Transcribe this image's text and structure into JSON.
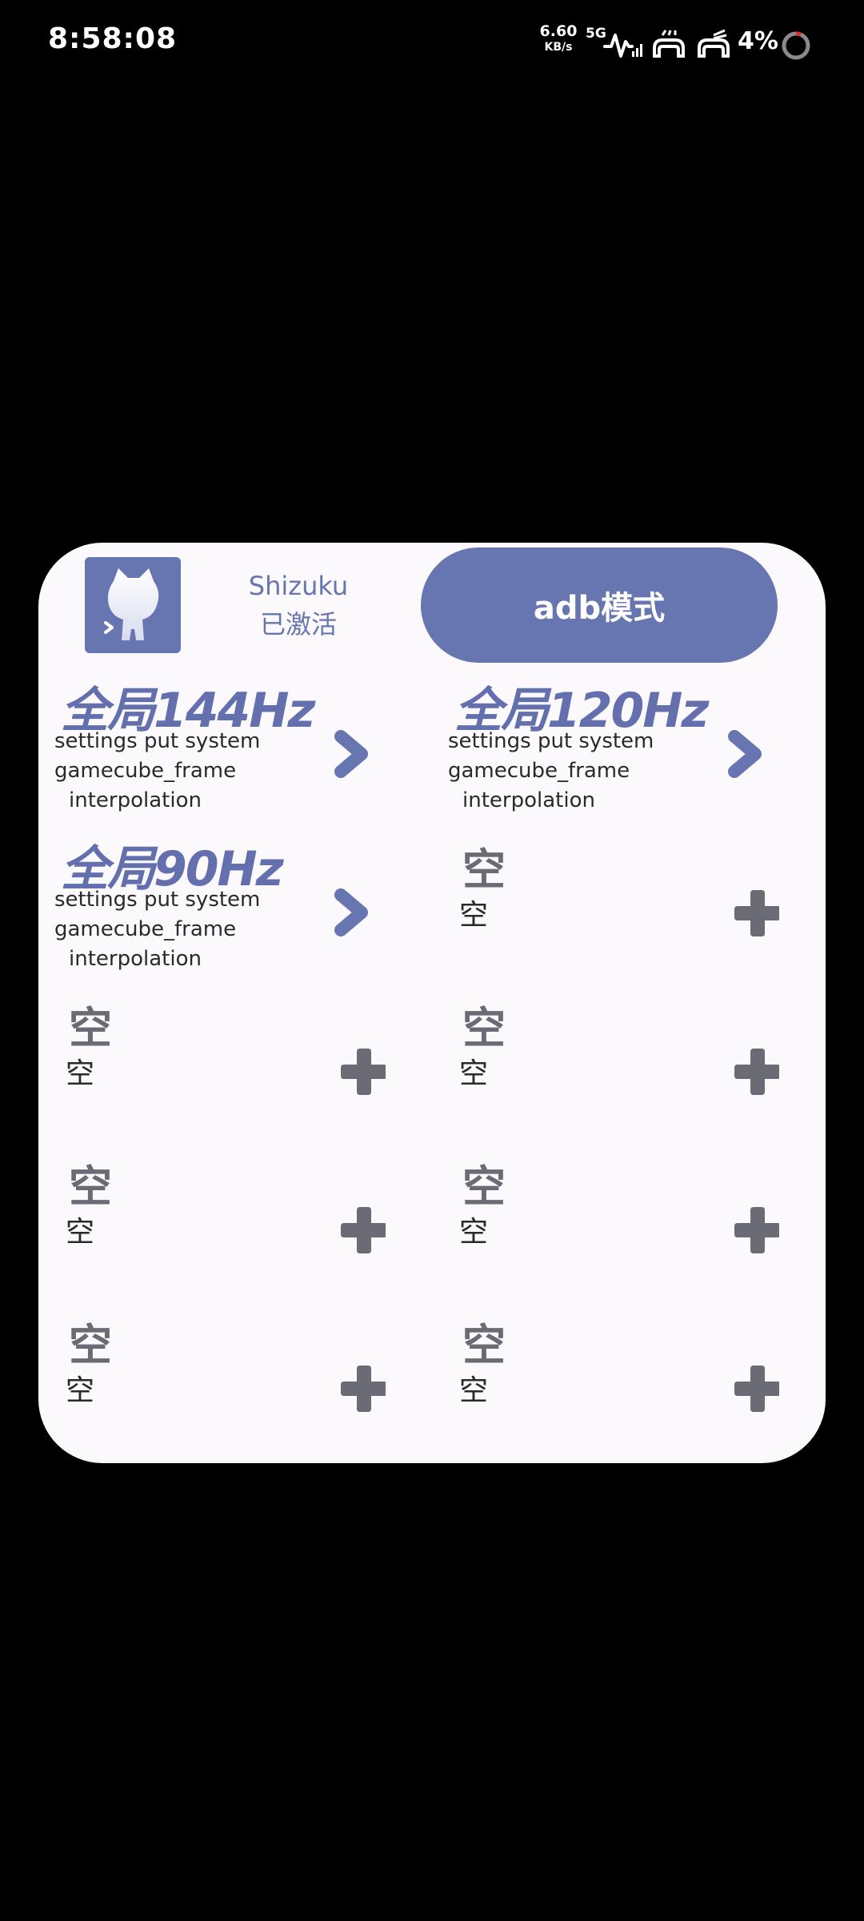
{
  "status_bar": {
    "time": "8:58:08",
    "net_speed_value": "6.60",
    "net_speed_unit": "KB/s",
    "network_type": "5G",
    "battery": "4%"
  },
  "header": {
    "app_icon": "shizuku-cat-icon",
    "shizuku_name": "Shizuku",
    "shizuku_status": "已激活",
    "mode_button": "adb模式"
  },
  "tiles": [
    {
      "title": "全局144Hz",
      "cmd_lines": [
        "settings put system",
        "gamecube_frame",
        "interpolation"
      ],
      "action_icon": "chevron-right-icon"
    },
    {
      "title": "全局120Hz",
      "cmd_lines": [
        "settings put system",
        "gamecube_frame",
        "interpolation"
      ],
      "action_icon": "chevron-right-icon"
    },
    {
      "title": "全局90Hz",
      "cmd_lines": [
        "settings put system",
        "gamecube_frame",
        "interpolation"
      ],
      "action_icon": "chevron-right-icon"
    },
    {
      "title": "空",
      "subtitle": "空",
      "action_icon": "plus-icon"
    },
    {
      "title": "空",
      "subtitle": "空",
      "action_icon": "plus-icon"
    },
    {
      "title": "空",
      "subtitle": "空",
      "action_icon": "plus-icon"
    },
    {
      "title": "空",
      "subtitle": "空",
      "action_icon": "plus-icon"
    },
    {
      "title": "空",
      "subtitle": "空",
      "action_icon": "plus-icon"
    },
    {
      "title": "空",
      "subtitle": "空",
      "action_icon": "plus-icon"
    },
    {
      "title": "空",
      "subtitle": "空",
      "action_icon": "plus-icon"
    }
  ],
  "colors": {
    "accent": "#6776b0",
    "panel_bg": "#fbf9fc",
    "empty_icon": "#6a6b74",
    "background": "#000000"
  }
}
